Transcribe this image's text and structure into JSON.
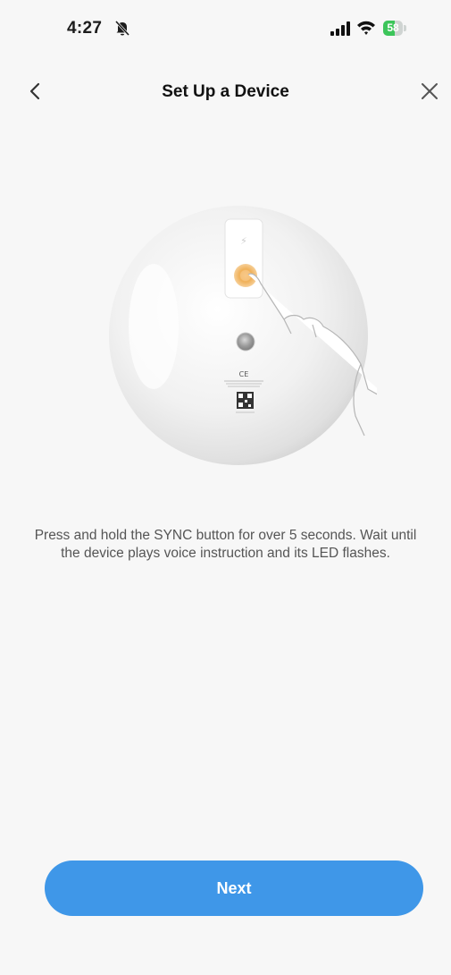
{
  "status_bar": {
    "time": "4:27",
    "battery_percent": 58,
    "battery_label": "58",
    "icons": [
      "bell-slash-icon",
      "signal-icon",
      "wifi-icon",
      "battery-icon"
    ]
  },
  "header": {
    "title": "Set Up a Device",
    "back_icon": "chevron-left-icon",
    "close_icon": "close-icon"
  },
  "illustration": {
    "label_mark": "CE"
  },
  "instruction": "Press and hold the SYNC button for over 5 seconds. Wait until the device plays voice instruction and its LED flashes.",
  "footer": {
    "next_label": "Next"
  },
  "colors": {
    "accent": "#3f97e8",
    "battery": "#3cc55a",
    "sync_button": "#f0b15a"
  }
}
